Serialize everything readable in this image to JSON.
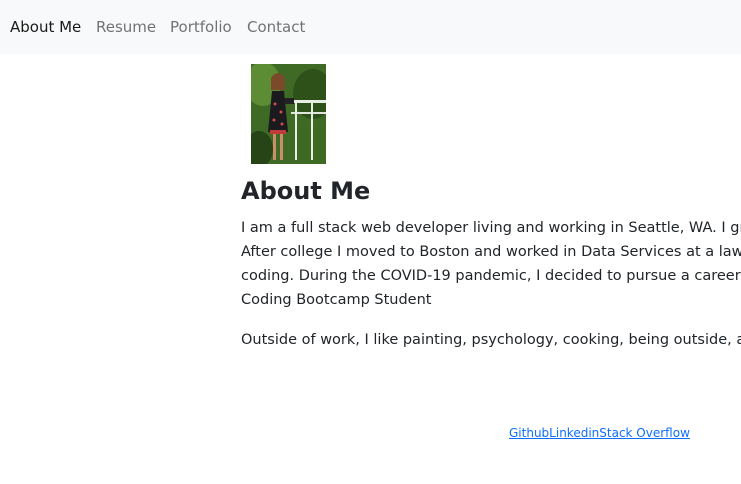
{
  "nav": {
    "items": [
      "About Me",
      "Resume",
      "Portfolio",
      "Contact"
    ],
    "active": "About Me"
  },
  "profile": {
    "photo_alt": "profile-photo"
  },
  "main": {
    "heading": "About Me",
    "bio_lines": [
      "I am a full stack web developer living and working in Seattle, WA. I gre",
      "After college I moved to Boston and worked in Data Services at a law",
      "coding. During the COVID-19 pandemic, I decided to pursue a career",
      "Coding Bootcamp Student"
    ],
    "hobbies": "Outside of work, I like painting, psychology, cooking, being outside, an"
  },
  "footer": {
    "links": [
      "Github",
      "Linkedin",
      "Stack Overflow"
    ]
  },
  "colors": {
    "navbar_bg": "#f8f9fa",
    "link": "#0d6efd",
    "text": "#212529"
  }
}
